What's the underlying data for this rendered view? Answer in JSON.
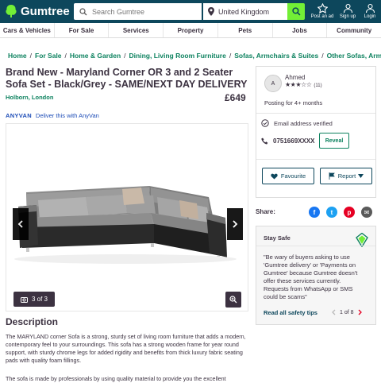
{
  "header": {
    "logo_text": "Gumtree",
    "search_placeholder": "Search Gumtree",
    "location": "United Kingdom",
    "icons": [
      {
        "name": "post-ad-icon",
        "label": "Post an ad"
      },
      {
        "name": "signup-icon",
        "label": "Sign up"
      },
      {
        "name": "login-icon",
        "label": "Login"
      }
    ]
  },
  "categories": [
    "Cars & Vehicles",
    "For Sale",
    "Services",
    "Property",
    "Pets",
    "Jobs",
    "Community"
  ],
  "breadcrumbs": [
    "Home",
    "For Sale",
    "Home & Garden",
    "Dining, Living Room Furniture",
    "Sofas, Armchairs & Suites",
    "Other Sofas, Armcha"
  ],
  "listing": {
    "title": "Brand New - Maryland Corner OR 3 and 2 Seater Sofa Set - Black/Grey - SAME/NEXT DAY DELIVERY",
    "location": "Holborn, London",
    "price": "£649",
    "delivery_brand": "ANYVAN",
    "delivery_text": "Deliver this with AnyVan",
    "image_counter": "3 of 3",
    "description_heading": "Description",
    "description_p1": "The MARYLAND corner Sofa is a strong, sturdy set of living room furniture that adds a modern, contemporary feel to your surroundings. This sofa has a strong wooden frame for year round support, with sturdy chrome legs for added rigidity and benefits from thick luxury fabric seating pads with quality foam fillings.",
    "description_p2": "The sofa is made by professionals by using quality material to provide you the excellent"
  },
  "seller": {
    "avatar_letter": "A",
    "name": "Ahmed",
    "rating": 3.5,
    "stars_text": "★★★☆☆",
    "review_count": "(11)",
    "posting_for": "Posting for 4+ months",
    "email_verified": "Email address verified",
    "phone": "0751669XXXX",
    "reveal_label": "Reveal",
    "favourite_label": "Favourite",
    "report_label": "Report"
  },
  "share": {
    "label": "Share:",
    "networks": [
      {
        "name": "facebook",
        "glyph": "f",
        "color": "#1877f2"
      },
      {
        "name": "twitter",
        "glyph": "t",
        "color": "#1da1f2"
      },
      {
        "name": "pinterest",
        "glyph": "p",
        "color": "#e60023"
      },
      {
        "name": "email",
        "glyph": "✉",
        "color": "#5a5a5a"
      }
    ]
  },
  "safety": {
    "title": "Stay Safe",
    "text": "\"Be wary of buyers asking to use 'Gumtree delivery' or 'Payments on Gumtree' because Gumtree doesn't offer these services currently. Requests from WhatsApp or SMS could be scams\"",
    "link": "Read all safety tips",
    "page": "1 of 8"
  },
  "colors": {
    "brand_dark": "#0d475c",
    "brand_green": "#72ef36",
    "link_green": "#0d825f"
  }
}
